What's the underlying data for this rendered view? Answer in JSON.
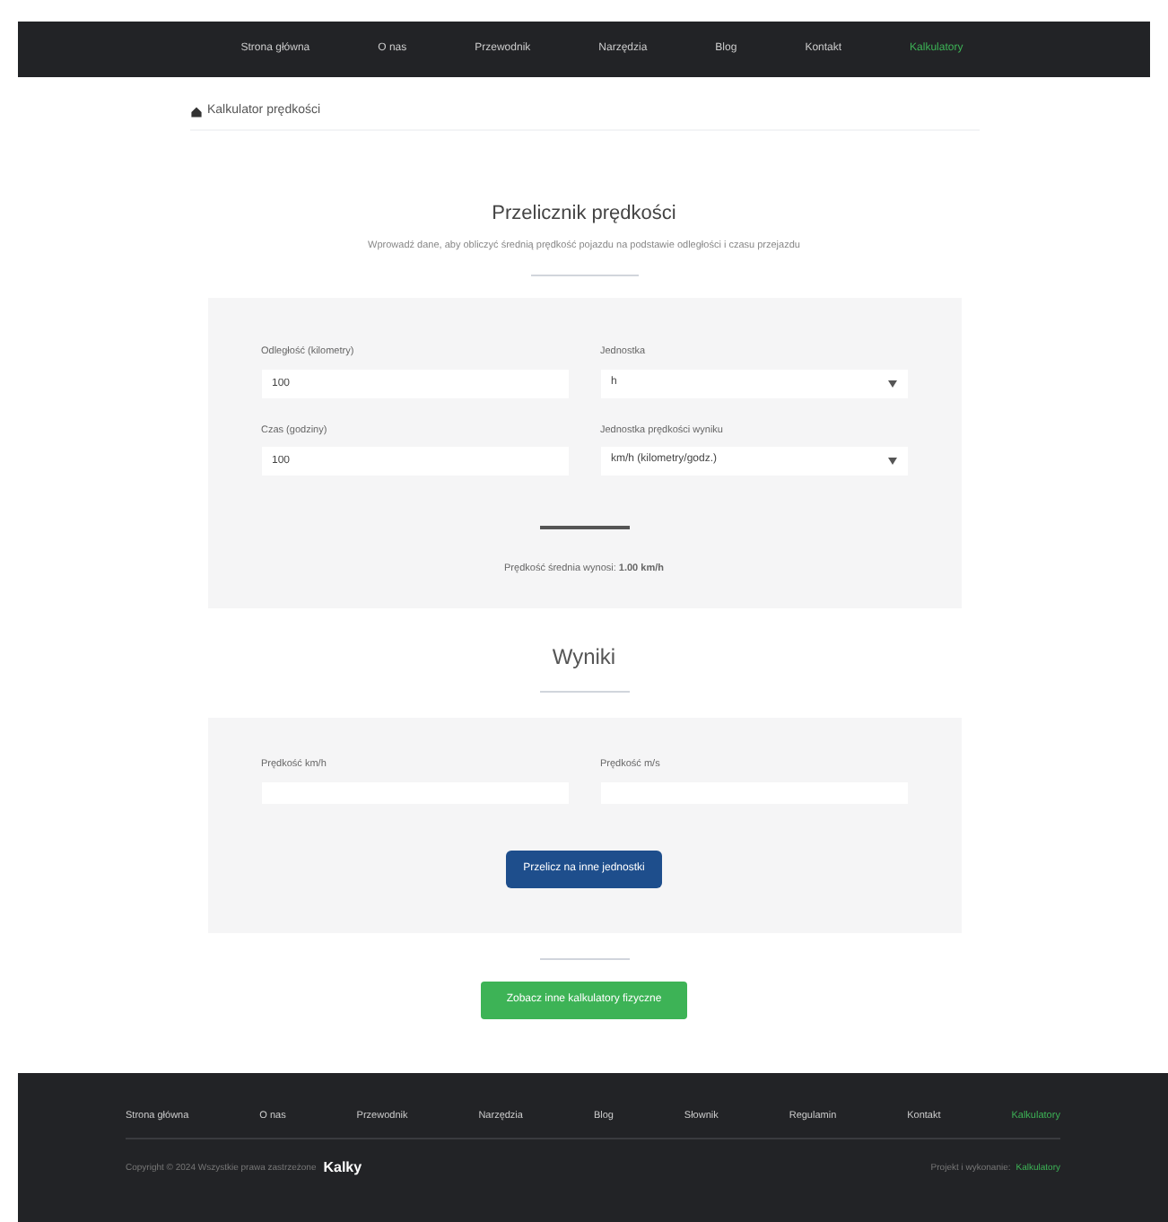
{
  "nav": [
    {
      "label": "Strona główna",
      "selected": false
    },
    {
      "label": "O nas",
      "selected": false
    },
    {
      "label": "Przewodnik",
      "selected": false
    },
    {
      "label": "Narzędzia",
      "selected": false
    },
    {
      "label": "Blog",
      "selected": false
    },
    {
      "label": "Kontakt",
      "selected": false
    },
    {
      "label": "Kalkulatory",
      "selected": true
    }
  ],
  "breadcrumb": "Kalkulator prędkości",
  "calculator": {
    "title": "Przelicznik prędkości",
    "subtitle": "Wprowadź dane, aby obliczyć średnią prędkość pojazdu na podstawie odległości i czasu przejazdu",
    "fields": [
      {
        "kind": "input",
        "label": "Odległość (kilometry)",
        "value": "100"
      },
      {
        "kind": "select",
        "label": "Jednostka",
        "value": "h"
      },
      {
        "kind": "input",
        "label": "Czas (godziny)",
        "value": "100"
      },
      {
        "kind": "select",
        "label": "Jednostka prędkości wyniku",
        "value": "km/h (kilometry/godz.)"
      }
    ],
    "result": "Prędkość średnia wynosi: **1.00 km/h**"
  },
  "results": {
    "title": "Wyniki",
    "fields": [
      {
        "label": "Prędkość km/h"
      },
      {
        "label": "Prędkość m/s"
      }
    ],
    "button": "Przelicz na inne jednostki"
  },
  "more_button": "Zobacz inne kalkulatory fizyczne",
  "footer": {
    "links": [
      {
        "label": "Strona główna",
        "selected": false
      },
      {
        "label": "O nas",
        "selected": false
      },
      {
        "label": "Przewodnik",
        "selected": false
      },
      {
        "label": "Narzędzia",
        "selected": false
      },
      {
        "label": "Blog",
        "selected": false
      },
      {
        "label": "Słownik",
        "selected": false
      },
      {
        "label": "Regulamin",
        "selected": false
      },
      {
        "label": "Kontakt",
        "selected": false
      },
      {
        "label": "Kalkulatory",
        "selected": true
      }
    ],
    "copyright": "Copyright © 2024 Wszystkie prawa zastrzeżone",
    "logo": "Kalky",
    "credit": "Projekt i wykonanie:",
    "credit_link": "Kalkulatory"
  }
}
